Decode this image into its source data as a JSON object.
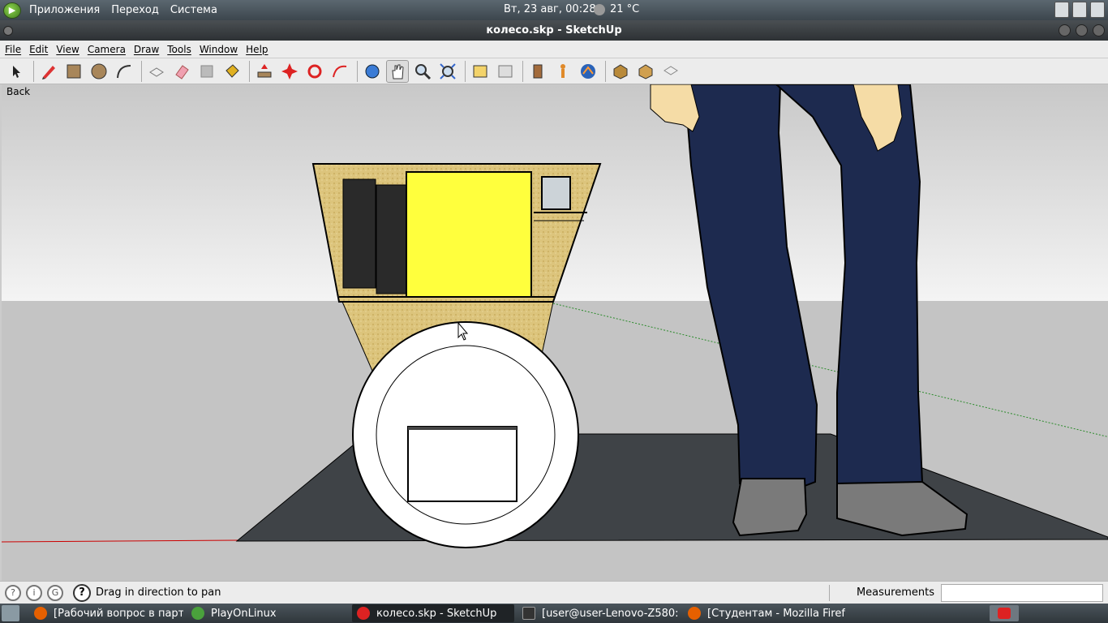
{
  "top_panel": {
    "menu_items": [
      "Приложения",
      "Переход",
      "Система"
    ],
    "clock": "Вт, 23 авг, 00:28",
    "temperature": "21 °C"
  },
  "window": {
    "title": "колесо.skp - SketchUp"
  },
  "menubar": {
    "items": [
      "File",
      "Edit",
      "View",
      "Camera",
      "Draw",
      "Tools",
      "Window",
      "Help"
    ]
  },
  "toolbar": {
    "tools": [
      "select-icon",
      "pencil-icon",
      "rectangle-icon",
      "circle-icon",
      "arc-icon",
      "make-component-icon",
      "eraser-icon",
      "tape-measure-icon",
      "paint-bucket-icon",
      "push-pull-icon",
      "move-icon",
      "rotate-icon",
      "follow-me-icon",
      "orbit-icon",
      "pan-icon",
      "zoom-icon",
      "zoom-extents-icon",
      "previous-view-icon",
      "next-view-icon",
      "position-camera-icon",
      "walk-icon",
      "look-around-icon",
      "get-models-icon",
      "share-model-icon",
      "get-components-icon"
    ],
    "active_tool": "pan-icon"
  },
  "viewport": {
    "scene_label": "Back",
    "sky_color": "#d8d8d8",
    "ground_color": "#c4c4c4",
    "accent": {
      "yellow_panel": "#ffff3d",
      "wood": "#d9c37a",
      "jeans": "#1d2a4f",
      "shoes": "#7a7a7a",
      "base_plate": "#3f4347"
    }
  },
  "statusbar": {
    "message": "Drag in direction to pan",
    "measurements_label": "Measurements",
    "measurements_value": ""
  },
  "taskbar": {
    "tasks": [
      {
        "label": "[Рабочий вопрос в парт…",
        "icon": "firefox-icon",
        "active": false
      },
      {
        "label": "PlayOnLinux",
        "icon": "playonlinux-icon",
        "active": false
      },
      {
        "label": "колесо.skp - SketchUp",
        "icon": "sketchup-icon",
        "active": true
      },
      {
        "label": "[user@user-Lenovo-Z580:…",
        "icon": "terminal-icon",
        "active": false
      },
      {
        "label": "[Студентам - Mozilla Firef…",
        "icon": "firefox-icon",
        "active": false
      }
    ]
  }
}
